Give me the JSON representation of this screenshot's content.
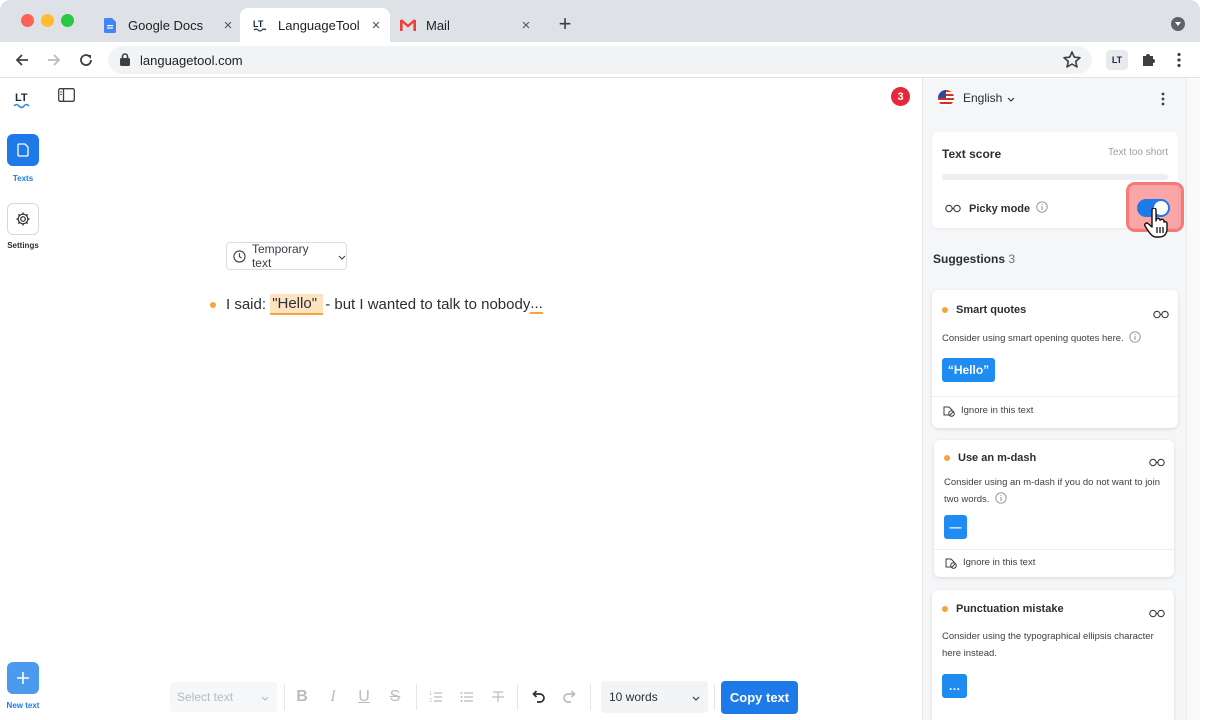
{
  "browser": {
    "tabs": [
      {
        "title": "Google Docs",
        "icon": "google-docs-icon"
      },
      {
        "title": "LanguageTool",
        "icon": "languagetool-icon",
        "active": true
      },
      {
        "title": "Mail",
        "icon": "gmail-icon"
      }
    ],
    "url": "languagetool.com",
    "lt_extension_label": "LT"
  },
  "sidebar": {
    "logo_text": "LT",
    "texts_label": "Texts",
    "settings_label": "Settings",
    "new_text_label": "New text"
  },
  "editor": {
    "issue_count": "3",
    "temporary_text_label": "Temporary text",
    "line": {
      "before": "I said: ",
      "highlighted": "\"Hello\" ",
      "middle": "- but I wanted to talk to nobody",
      "underlined": "..."
    },
    "toolbar": {
      "select_text_placeholder": "Select text",
      "word_count": "10 words",
      "copy_button": "Copy text"
    }
  },
  "right_panel": {
    "language": "English",
    "text_score": {
      "title": "Text score",
      "note": "Text too short",
      "picky_mode_label": "Picky mode",
      "picky_mode_on": true
    },
    "suggestions_label": "Suggestions",
    "suggestions_count": "3",
    "cards": [
      {
        "title": "Smart quotes",
        "description": "Consider using smart opening quotes here.",
        "replacement": "“Hello”",
        "ignore_label": "Ignore in this text"
      },
      {
        "title": "Use an m-dash",
        "description": "Consider using an m-dash if you do not want to join two words.",
        "replacement": "—",
        "ignore_label": "Ignore in this text"
      },
      {
        "title": "Punctuation mistake",
        "description": "Consider using the typographical ellipsis character here instead.",
        "replacement": "…"
      }
    ]
  },
  "colors": {
    "accent": "#1f7ae9",
    "warning": "#f4a53b",
    "badge": "#e5283c"
  }
}
